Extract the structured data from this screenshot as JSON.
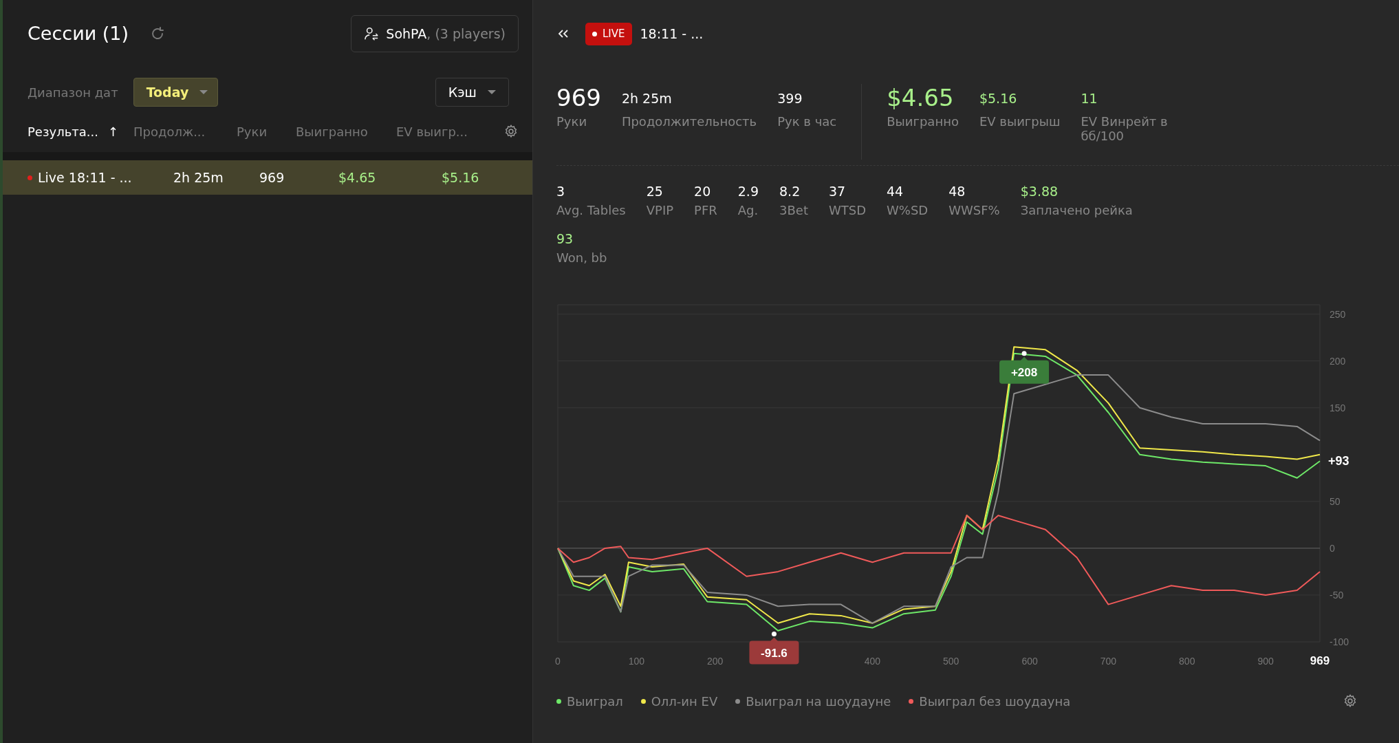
{
  "sessions_panel": {
    "title": "Сессии (1)",
    "player": {
      "name": "SohPA",
      "suffix": ", (3 players)"
    },
    "filters": {
      "date_label": "Диапазон дат",
      "date_range": "Today",
      "game_type": "Кэш"
    },
    "columns": [
      {
        "label": "Результа...",
        "sorted": true,
        "sort_arrow": "↑"
      },
      {
        "label": "Продолж...",
        "sorted": false
      },
      {
        "label": "Руки",
        "sorted": false
      },
      {
        "label": "Выигранно",
        "sorted": false
      },
      {
        "label": "EV выигр...",
        "sorted": false
      }
    ],
    "rows": [
      {
        "selected": true,
        "live": true,
        "cells": [
          {
            "text": "Live 18:11 - ...",
            "kind": "text"
          },
          {
            "text": "2h 25m",
            "kind": "text"
          },
          {
            "text": "969",
            "kind": "text"
          },
          {
            "text": "$4.65",
            "kind": "money"
          },
          {
            "text": "$5.16",
            "kind": "money"
          }
        ]
      }
    ]
  },
  "session_detail": {
    "badge": "LIVE",
    "title": "18:11 - ...",
    "summary_groups": [
      [
        {
          "value": "969",
          "label": "Руки",
          "large": true,
          "positive": false
        },
        {
          "value": "2h 25m",
          "label": "Продолжительность",
          "large": false,
          "positive": false
        },
        {
          "value": "399",
          "label": "Рук в час",
          "large": false,
          "positive": false
        }
      ],
      [
        {
          "value": "$4.65",
          "label": "Выигранно",
          "large": true,
          "positive": true
        },
        {
          "value": "$5.16",
          "label": "EV выигрыш",
          "large": false,
          "positive": true
        },
        {
          "value": "11",
          "label": "EV Винрейт в бб/100",
          "large": false,
          "positive": true
        }
      ]
    ],
    "stats": [
      {
        "value": "3",
        "label": "Avg. Tables",
        "positive": false
      },
      {
        "value": "25",
        "label": "VPIP",
        "positive": false
      },
      {
        "value": "20",
        "label": "PFR",
        "positive": false
      },
      {
        "value": "2.9",
        "label": "Ag.",
        "positive": false
      },
      {
        "value": "8.2",
        "label": "3Bet",
        "positive": false
      },
      {
        "value": "37",
        "label": "WTSD",
        "positive": false
      },
      {
        "value": "44",
        "label": "W%SD",
        "positive": false
      },
      {
        "value": "48",
        "label": "WWSF%",
        "positive": false
      },
      {
        "value": "$3.88",
        "label": "Заплачено рейка",
        "positive": true
      }
    ],
    "won_bb": {
      "value": "93",
      "label": "Won, bb",
      "positive": true
    },
    "chart_data": {
      "type": "line",
      "grid": true,
      "x": [
        0,
        20,
        40,
        60,
        80,
        90,
        120,
        160,
        190,
        240,
        280,
        320,
        360,
        400,
        440,
        480,
        500,
        520,
        540,
        560,
        580,
        620,
        660,
        700,
        740,
        780,
        820,
        860,
        900,
        940,
        969
      ],
      "series": [
        {
          "name": "Выиграл",
          "color": "#6ee868",
          "values": [
            0,
            -40,
            -45,
            -32,
            -68,
            -20,
            -25,
            -22,
            -57,
            -60,
            -88,
            -78,
            -80,
            -85,
            -70,
            -66,
            -30,
            28,
            15,
            85,
            208,
            205,
            185,
            145,
            100,
            95,
            92,
            90,
            88,
            75,
            93
          ]
        },
        {
          "name": "Олл-ин EV",
          "color": "#f0e84a",
          "values": [
            0,
            -35,
            -40,
            -28,
            -62,
            -15,
            -20,
            -17,
            -52,
            -55,
            -80,
            -70,
            -72,
            -80,
            -65,
            -62,
            -25,
            35,
            20,
            95,
            215,
            212,
            190,
            155,
            107,
            105,
            103,
            100,
            98,
            95,
            100
          ]
        },
        {
          "name": "Выиграл на шоудауне",
          "color": "#8c8c8c",
          "values": [
            0,
            -30,
            -30,
            -30,
            -68,
            -30,
            -18,
            -18,
            -47,
            -50,
            -62,
            -60,
            -60,
            -80,
            -62,
            -62,
            -20,
            -10,
            -10,
            60,
            165,
            175,
            185,
            185,
            150,
            140,
            133,
            133,
            133,
            130,
            115
          ]
        },
        {
          "name": "Выиграл без шоудауна",
          "color": "#f05a5a",
          "values": [
            0,
            -15,
            -10,
            0,
            2,
            -10,
            -12,
            -5,
            0,
            -30,
            -25,
            -15,
            -5,
            -15,
            -5,
            -5,
            -5,
            35,
            20,
            35,
            30,
            20,
            -10,
            -60,
            -50,
            -40,
            -45,
            -45,
            -50,
            -45,
            -25
          ]
        }
      ],
      "xlim": [
        0,
        969
      ],
      "ylim": [
        -100,
        260
      ],
      "xticks": [
        0,
        100,
        200,
        400,
        500,
        600,
        700,
        800,
        900,
        {
          "value": 969,
          "label": "969"
        }
      ],
      "yticks": [
        -100,
        -50,
        0,
        50,
        150,
        200,
        250
      ],
      "annotations": [
        {
          "x": 593,
          "y": 208,
          "text": "+208"
        },
        {
          "x": 275,
          "y": -91.6,
          "text": "-91.6"
        },
        {
          "x": 969,
          "y": 93,
          "text": "+93"
        }
      ]
    }
  }
}
